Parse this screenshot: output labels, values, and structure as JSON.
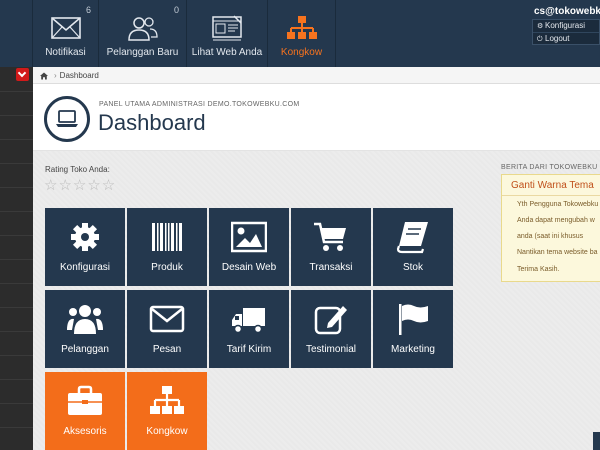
{
  "topnav": {
    "items": [
      {
        "label": "Notifikasi",
        "count": "6",
        "icon": "envelope-icon"
      },
      {
        "label": "Pelanggan Baru",
        "count": "0",
        "icon": "users-icon"
      },
      {
        "label": "Lihat Web Anda",
        "count": "",
        "icon": "web-icon"
      },
      {
        "label": "Kongkow",
        "count": "",
        "icon": "sitemap-icon"
      }
    ],
    "active_color": "#f7731e"
  },
  "user": {
    "email": "cs@tokowebku.c",
    "menu": [
      {
        "label": "Konfigurasi",
        "icon": "gear-icon"
      },
      {
        "label": "Logout",
        "icon": "power-icon"
      }
    ]
  },
  "breadcrumb": {
    "label": "Dashboard"
  },
  "header": {
    "subtitle": "PANEL UTAMA ADMINISTRASI DEMO.TOKOWEBKU.COM",
    "title": "Dashboard"
  },
  "rating": {
    "label": "Rating Toko Anda:",
    "stars": "☆☆☆☆☆"
  },
  "tiles": [
    {
      "label": "Konfigurasi",
      "icon": "gear-icon"
    },
    {
      "label": "Produk",
      "icon": "barcode-icon"
    },
    {
      "label": "Desain Web",
      "icon": "image-icon"
    },
    {
      "label": "Transaksi",
      "icon": "cart-icon"
    },
    {
      "label": "Stok",
      "icon": "book-icon"
    },
    {
      "label": "Pelanggan",
      "icon": "users-icon"
    },
    {
      "label": "Pesan",
      "icon": "envelope-icon"
    },
    {
      "label": "Tarif Kirim",
      "icon": "truck-icon"
    },
    {
      "label": "Testimonial",
      "icon": "edit-icon"
    },
    {
      "label": "Marketing",
      "icon": "flag-icon"
    },
    {
      "label": "Aksesoris",
      "icon": "briefcase-icon"
    },
    {
      "label": "Kongkow",
      "icon": "sitemap-icon"
    }
  ],
  "news": {
    "heading": "BERITA DARI TOKOWEBKU",
    "title": "Ganti Warna Tema",
    "lines": [
      "Yth Pengguna Tokowebku",
      "Anda dapat mengubah w",
      "anda (saat ini khusus",
      "Nantikan tema website ba",
      "",
      "Terima Kasih."
    ]
  },
  "colors": {
    "navy": "#24384e",
    "orange": "#f36d1a",
    "danger": "#d11a1a"
  }
}
